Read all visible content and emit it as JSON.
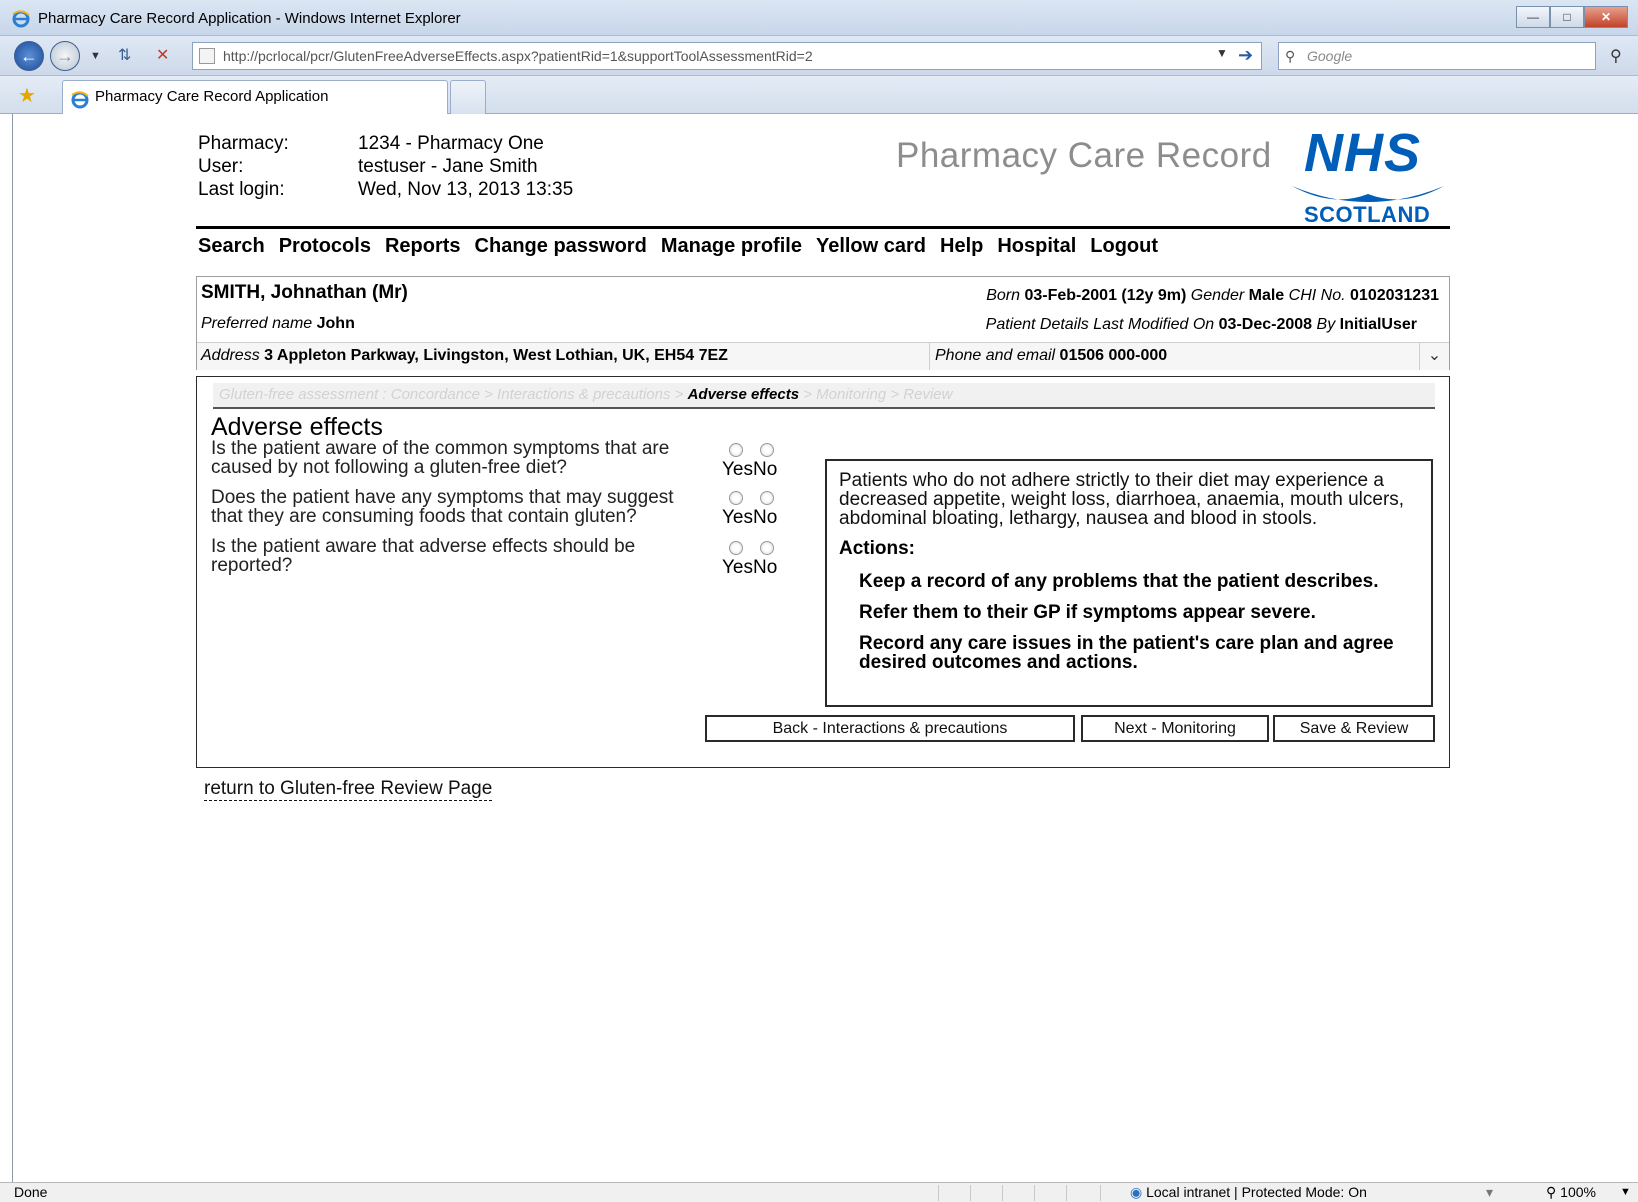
{
  "browser": {
    "window_title": "Pharmacy Care Record Application - Windows Internet Explorer",
    "url": "http://pcrlocal/pcr/GlutenFreeAdverseEffects.aspx?patientRid=1&supportToolAssessmentRid=2",
    "search_placeholder": "Google",
    "tab_title": "Pharmacy Care Record Application",
    "status_text": "Done",
    "zone_text": "Local intranet | Protected Mode: On",
    "zoom_text": "100%"
  },
  "header": {
    "pharmacy_label": "Pharmacy:",
    "pharmacy_value": "1234 - Pharmacy One",
    "user_label": "User:",
    "user_value": "testuser - Jane Smith",
    "last_login_label": "Last login:",
    "last_login_value": "Wed, Nov 13, 2013 13:35",
    "brand_text": "Pharmacy Care Record",
    "logo_nhs": "NHS",
    "logo_scotland": "SCOTLAND",
    "brand_color": "#005eb8"
  },
  "nav": {
    "items": [
      "Search",
      "Protocols",
      "Reports",
      "Change password",
      "Manage profile",
      "Yellow card",
      "Help",
      "Hospital",
      "Logout"
    ]
  },
  "patient": {
    "name": "SMITH, Johnathan (Mr)",
    "preferred_label": "Preferred name",
    "preferred_value": "John",
    "born_label": "Born",
    "born_value": "03-Feb-2001",
    "age_value": "(12y 9m)",
    "gender_label": "Gender",
    "gender_value": "Male",
    "chi_label": "CHI No.",
    "chi_value": "0102031231",
    "modified_label": "Patient Details Last Modified On",
    "modified_value": "03-Dec-2008",
    "by_label": "By",
    "by_value": "InitialUser",
    "address_label": "Address",
    "address_value": "3 Appleton Parkway, Livingston, West Lothian, UK, EH54 7EZ",
    "phone_label": "Phone and email",
    "phone_value": "01506 000-000"
  },
  "wizard": {
    "steps_before": "Gluten-free assessment : Concordance > Interactions & precautions >",
    "current_step": "Adverse effects",
    "steps_after": "> Monitoring > Review",
    "heading": "Adverse effects",
    "questions": [
      {
        "text": "Is the patient aware of the common symptoms that are caused by not following a gluten-free diet?",
        "yes": "Yes",
        "no": "No"
      },
      {
        "text": "Does the patient have any symptoms that may suggest that they are consuming foods that contain gluten?",
        "yes": "Yes",
        "no": "No"
      },
      {
        "text": "Is the patient aware that adverse effects should be reported?",
        "yes": "Yes",
        "no": "No"
      }
    ],
    "advice_text": "Patients who do not adhere strictly to their diet may experience a decreased appetite, weight loss, diarrhoea, anaemia, mouth ulcers, abdominal bloating, lethargy, nausea and blood in stools.",
    "actions_heading": "Actions:",
    "actions": [
      "Keep a record of any problems that the patient describes.",
      "Refer them to their GP if symptoms appear severe.",
      "Record any care issues in the patient's care plan and agree desired outcomes and actions."
    ],
    "back_label": "Back - Interactions & precautions",
    "next_label": "Next - Monitoring",
    "save_label": "Save & Review"
  },
  "return_link": "return to Gluten-free Review Page"
}
